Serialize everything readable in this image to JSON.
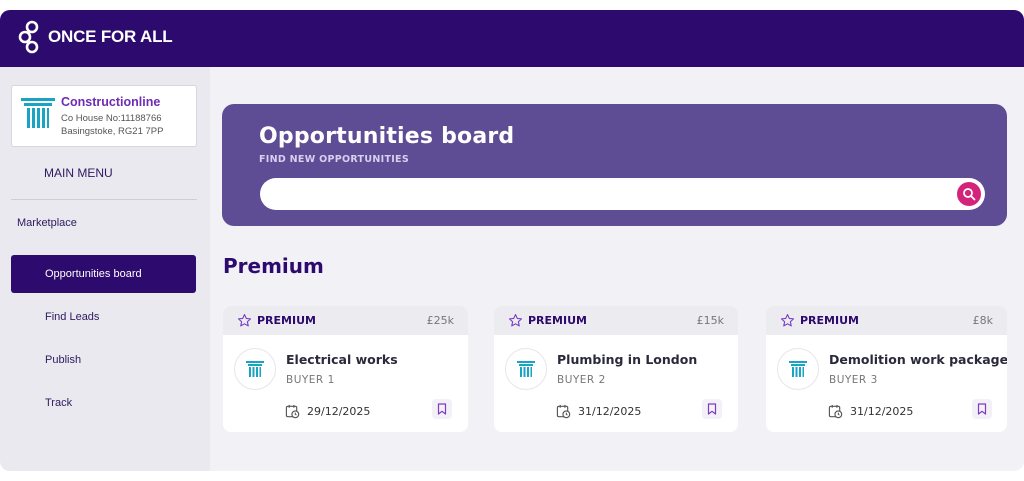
{
  "app": {
    "brand": "ONCE FOR ALL"
  },
  "sidebar": {
    "org": {
      "name": "Constructionline",
      "company_no": "Co House No:11188766",
      "address": "Basingstoke, RG21 7PP"
    },
    "main_menu_label": "MAIN MENU",
    "section_label": "Marketplace",
    "items": [
      {
        "label": "Opportunities board",
        "active": true
      },
      {
        "label": "Find Leads",
        "active": false
      },
      {
        "label": "Publish",
        "active": false
      },
      {
        "label": "Track",
        "active": false
      }
    ]
  },
  "hero": {
    "title": "Opportunities board",
    "subtitle": "FIND NEW OPPORTUNITIES",
    "search_value": "",
    "search_placeholder": ""
  },
  "section": {
    "heading": "Premium"
  },
  "cards": [
    {
      "badge": "PREMIUM",
      "value": "£25k",
      "title": "Electrical works",
      "buyer": "BUYER 1",
      "date": "29/12/2025"
    },
    {
      "badge": "PREMIUM",
      "value": "£15k",
      "title": "Plumbing in London",
      "buyer": "BUYER 2",
      "date": "31/12/2025"
    },
    {
      "badge": "PREMIUM",
      "value": "£8k",
      "title": "Demolition work package",
      "buyer": "BUYER 3",
      "date": "31/12/2025"
    }
  ],
  "colors": {
    "brand": "#2d0a6e",
    "hero": "#5e4c95",
    "accent": "#d4237a",
    "logo_teal": "#1aa4c4"
  },
  "icons": {
    "brand": "once-for-all-logo",
    "search": "search-icon",
    "premium": "star-outline-icon",
    "date": "calendar-clock-icon",
    "bookmark": "bookmark-icon",
    "buyer": "constructionline-pillar-icon"
  }
}
